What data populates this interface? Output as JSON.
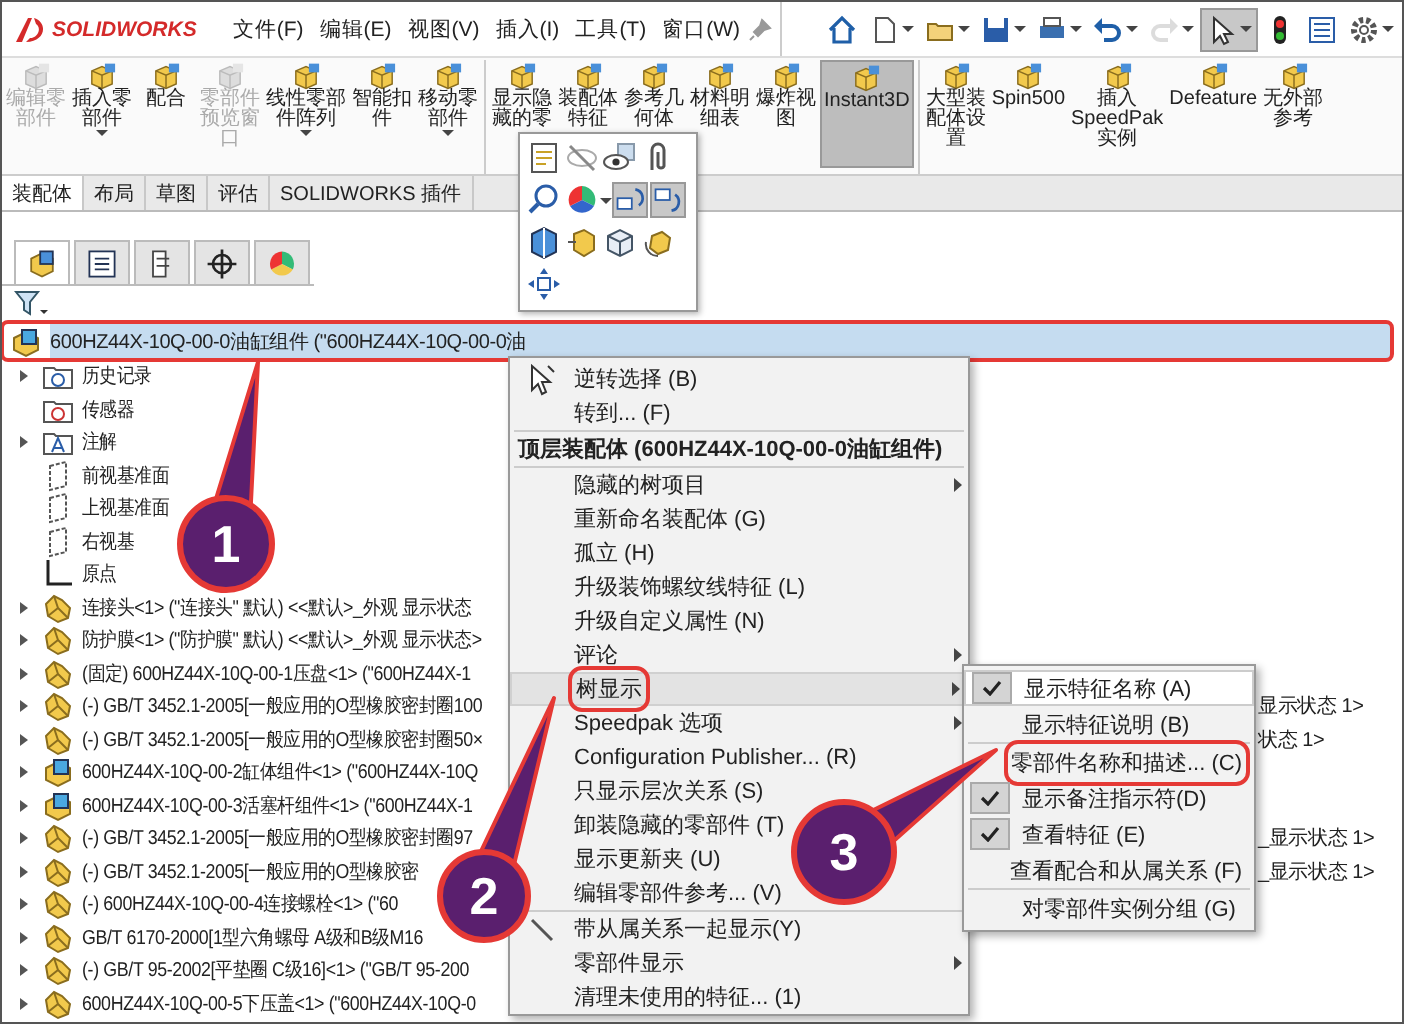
{
  "menubar": {
    "logo": "SOLIDWORKS",
    "menus": [
      "文件(F)",
      "编辑(E)",
      "视图(V)",
      "插入(I)",
      "工具(T)",
      "窗口(W)"
    ],
    "tools": [
      {
        "selected": false,
        "disabled": false
      },
      {
        "selected": false,
        "disabled": false
      },
      {
        "selected": false,
        "disabled": false
      },
      {
        "selected": false,
        "disabled": false
      },
      {
        "selected": false,
        "disabled": false
      },
      {
        "selected": false,
        "disabled": false
      },
      {
        "selected": false,
        "disabled": true
      },
      {
        "selected": true,
        "disabled": false
      },
      {
        "selected": false,
        "disabled": false
      },
      {
        "selected": false,
        "disabled": false
      },
      {
        "selected": false,
        "disabled": false
      }
    ]
  },
  "ribbon": {
    "groups": [
      {
        "buttons": [
          {
            "lines": [
              "编辑零",
              "部件"
            ],
            "disabled": true,
            "selected": false,
            "dropdown": false
          },
          {
            "lines": [
              "插入零",
              "部件"
            ],
            "disabled": false,
            "selected": false,
            "dropdown": true
          },
          {
            "lines": [
              "配合"
            ],
            "disabled": false,
            "selected": false,
            "dropdown": false
          },
          {
            "lines": [
              "零部件",
              "预览窗",
              "口"
            ],
            "disabled": true,
            "selected": false,
            "dropdown": false
          },
          {
            "lines": [
              "线性零部",
              "件阵列"
            ],
            "disabled": false,
            "selected": false,
            "dropdown": true
          },
          {
            "lines": [
              "智能扣",
              "件"
            ],
            "disabled": false,
            "selected": false,
            "dropdown": false
          },
          {
            "lines": [
              "移动零",
              "部件"
            ],
            "disabled": false,
            "selected": false,
            "dropdown": true
          }
        ]
      },
      {
        "buttons": [
          {
            "lines": [
              "显示隐",
              "藏的零"
            ],
            "disabled": false,
            "selected": false,
            "dropdown": false
          },
          {
            "lines": [
              "装配体",
              "特征"
            ],
            "disabled": false,
            "selected": false,
            "dropdown": false
          },
          {
            "lines": [
              "参考几",
              "何体"
            ],
            "disabled": false,
            "selected": false,
            "dropdown": false
          },
          {
            "lines": [
              "材料明",
              "细表"
            ],
            "disabled": false,
            "selected": false,
            "dropdown": false
          },
          {
            "lines": [
              "爆炸视",
              "图"
            ],
            "disabled": false,
            "selected": false,
            "dropdown": false
          },
          {
            "lines": [
              "Instant3D"
            ],
            "disabled": false,
            "selected": true,
            "dropdown": false
          }
        ]
      },
      {
        "buttons": [
          {
            "lines": [
              "大型装",
              "配体设",
              "置"
            ],
            "disabled": false,
            "selected": false,
            "dropdown": false
          },
          {
            "lines": [
              "Spin500"
            ],
            "disabled": false,
            "selected": false,
            "dropdown": false
          },
          {
            "lines": [
              "插入",
              "SpeedPak",
              "实例"
            ],
            "disabled": false,
            "selected": false,
            "dropdown": false
          },
          {
            "lines": [
              "Defeature"
            ],
            "disabled": false,
            "selected": false,
            "dropdown": false
          },
          {
            "lines": [
              "无外部",
              "参考"
            ],
            "disabled": false,
            "selected": false,
            "dropdown": false
          }
        ]
      }
    ]
  },
  "tabs": [
    {
      "label": "装配体",
      "selected": true
    },
    {
      "label": "布局",
      "selected": false
    },
    {
      "label": "草图",
      "selected": false
    },
    {
      "label": "评估",
      "selected": false
    },
    {
      "label": "SOLIDWORKS 插件",
      "selected": false
    }
  ],
  "popup_toolbar": [
    {
      "selected": false
    },
    {
      "selected": false
    },
    {
      "selected": false
    },
    {
      "selected": false
    },
    {
      "selected": false
    },
    {
      "selected": false
    },
    {
      "selected": true
    },
    {
      "selected": true
    },
    {
      "selected": false
    },
    {
      "selected": false
    },
    {
      "selected": false
    },
    {
      "selected": false
    },
    {
      "selected": false
    }
  ],
  "panel_tabs": [
    {
      "selected": true
    },
    {
      "selected": false
    },
    {
      "selected": false
    },
    {
      "selected": false
    },
    {
      "selected": false
    }
  ],
  "tree": {
    "kind": "assembly",
    "text": "600HZ44X-10Q-00-0油缸组件 (\"600HZ44X-10Q-00-0油",
    "selected": true,
    "boxed": true,
    "children": [
      {
        "kind": "history",
        "text": "历史记录",
        "expandable": true
      },
      {
        "kind": "sensor",
        "text": "传感器",
        "expandable": false
      },
      {
        "kind": "annotation",
        "text": "注解",
        "expandable": true
      },
      {
        "kind": "plane",
        "text": "前视基准面",
        "expandable": false
      },
      {
        "kind": "plane",
        "text": "上视基准面",
        "expandable": false
      },
      {
        "kind": "plane",
        "text": "右视基",
        "expandable": false
      },
      {
        "kind": "origin",
        "text": "原点",
        "expandable": false
      },
      {
        "kind": "part",
        "text": "连接头<1> (\"连接头\" 默认) <<默认>_外观 显示状态",
        "expandable": true
      },
      {
        "kind": "part",
        "text": "防护膜<1> (\"防护膜\" 默认) <<默认>_外观 显示状态>",
        "expandable": true
      },
      {
        "kind": "part",
        "text": "(固定) 600HZ44X-10Q-00-1压盘<1> (\"600HZ44X-1",
        "expandable": true
      },
      {
        "kind": "part",
        "text": "(-) GB/T 3452.1-2005[一般应用的O型橡胶密封圈100",
        "expandable": true,
        "tail": "显示状态 1>"
      },
      {
        "kind": "part",
        "text": "(-) GB/T 3452.1-2005[一般应用的O型橡胶密封圈50×",
        "expandable": true,
        "tail": "状态 1>"
      },
      {
        "kind": "assembly",
        "text": "600HZ44X-10Q-00-2缸体组件<1> (\"600HZ44X-10Q",
        "expandable": true
      },
      {
        "kind": "assembly",
        "text": "600HZ44X-10Q-00-3活塞杆组件<1> (\"600HZ44X-1",
        "expandable": true
      },
      {
        "kind": "part",
        "text": "(-) GB/T 3452.1-2005[一般应用的O型橡胶密封圈97",
        "expandable": true,
        "tail": "_显示状态 1>"
      },
      {
        "kind": "part",
        "text": "(-) GB/T 3452.1-2005[一般应用的O型橡胶密",
        "expandable": true,
        "tail": "_显示状态 1>"
      },
      {
        "kind": "part",
        "text": "(-) 600HZ44X-10Q-00-4连接螺栓<1> (\"60",
        "expandable": true
      },
      {
        "kind": "part",
        "text": "GB/T 6170-2000[1型六角螺母 A级和B级M16",
        "expandable": true
      },
      {
        "kind": "part",
        "text": "(-) GB/T 95-2002[平垫圈 C级16]<1> (\"GB/T 95-200",
        "expandable": true
      },
      {
        "kind": "part",
        "text": "600HZ44X-10Q-00-5下压盖<1> (\"600HZ44X-10Q-0",
        "expandable": true
      }
    ]
  },
  "context_menu": [
    {
      "kind": "item",
      "text": "逆转选择 (B)",
      "submenu": false,
      "selected": false,
      "boxed": false
    },
    {
      "kind": "item",
      "text": "转到... (F)",
      "submenu": false,
      "selected": false,
      "boxed": false
    },
    {
      "kind": "separator"
    },
    {
      "kind": "header",
      "text": "顶层装配体 (600HZ44X-10Q-00-0油缸组件)"
    },
    {
      "kind": "separator"
    },
    {
      "kind": "item",
      "text": "隐藏的树项目",
      "submenu": true,
      "selected": false,
      "boxed": false
    },
    {
      "kind": "item",
      "text": "重新命名装配体 (G)",
      "submenu": false,
      "selected": false,
      "boxed": false
    },
    {
      "kind": "item",
      "text": "孤立 (H)",
      "submenu": false,
      "selected": false,
      "boxed": false
    },
    {
      "kind": "item",
      "text": "升级装饰螺纹线特征 (L)",
      "submenu": false,
      "selected": false,
      "boxed": false
    },
    {
      "kind": "item",
      "text": "升级自定义属性 (N)",
      "submenu": false,
      "selected": false,
      "boxed": false
    },
    {
      "kind": "item",
      "text": "评论",
      "submenu": true,
      "selected": false,
      "boxed": false
    },
    {
      "kind": "item",
      "text": "树显示",
      "submenu": true,
      "selected": true,
      "boxed": true
    },
    {
      "kind": "item",
      "text": "Speedpak 选项",
      "submenu": true,
      "selected": false,
      "boxed": false
    },
    {
      "kind": "item",
      "text": "Configuration Publisher... (R)",
      "submenu": false,
      "selected": false,
      "boxed": false
    },
    {
      "kind": "item",
      "text": "只显示层次关系 (S)",
      "submenu": false,
      "selected": false,
      "boxed": false
    },
    {
      "kind": "item",
      "text": "卸装隐藏的零部件 (T)",
      "submenu": false,
      "selected": false,
      "boxed": false
    },
    {
      "kind": "item",
      "text": "显示更新夹 (U)",
      "submenu": false,
      "selected": false,
      "boxed": false
    },
    {
      "kind": "item",
      "text": "编辑零部件参考... (V)",
      "submenu": false,
      "selected": false,
      "boxed": false
    },
    {
      "kind": "separator"
    },
    {
      "kind": "item",
      "text": "带从属关系一起显示(Y)",
      "submenu": false,
      "selected": false,
      "boxed": false
    },
    {
      "kind": "item",
      "text": "零部件显示",
      "submenu": true,
      "selected": false,
      "boxed": false
    },
    {
      "kind": "item",
      "text": "清理未使用的特征... (1)",
      "submenu": false,
      "selected": false,
      "boxed": false
    }
  ],
  "submenu": [
    {
      "kind": "item",
      "text": "显示特征名称 (A)",
      "checked": true,
      "selected": true,
      "boxed": false
    },
    {
      "kind": "item",
      "text": "显示特征说明 (B)",
      "checked": false,
      "selected": false,
      "boxed": false
    },
    {
      "kind": "separator"
    },
    {
      "kind": "item",
      "text": "零部件名称和描述... (C)",
      "checked": false,
      "selected": false,
      "boxed": true
    },
    {
      "kind": "item",
      "text": "显示备注指示符(D)",
      "checked": true,
      "selected": false,
      "boxed": false
    },
    {
      "kind": "item",
      "text": "查看特征 (E)",
      "checked": true,
      "selected": false,
      "boxed": false
    },
    {
      "kind": "item",
      "text": "查看配合和从属关系 (F)",
      "checked": false,
      "selected": false,
      "boxed": false
    },
    {
      "kind": "separator"
    },
    {
      "kind": "item",
      "text": "对零部件实例分组 (G)",
      "checked": false,
      "selected": false,
      "boxed": false
    }
  ],
  "callouts": [
    "1",
    "2",
    "3"
  ]
}
